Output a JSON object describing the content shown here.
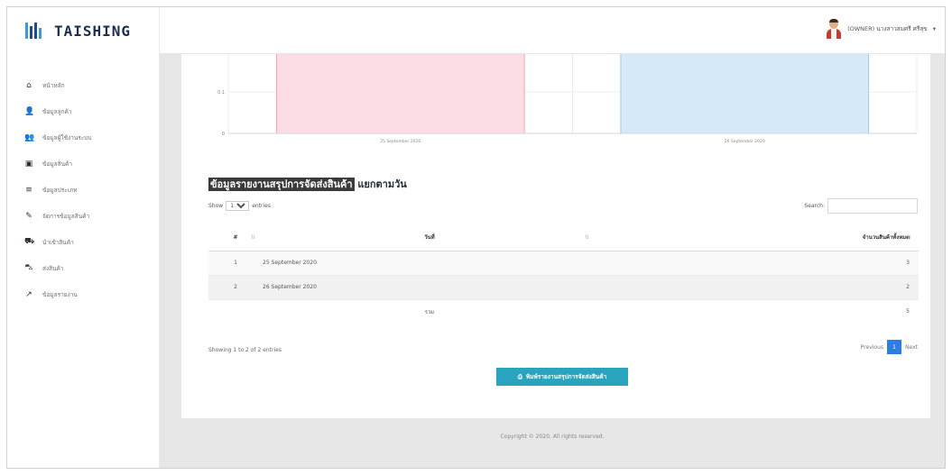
{
  "brand": {
    "name": "TAISHING"
  },
  "user": {
    "name": "(OWNER) นางสาวสมศรี ศรีสุข"
  },
  "sidebar": {
    "items": [
      {
        "label": "หน้าหลัก",
        "icon": "home-icon",
        "glyph": "⌂"
      },
      {
        "label": "ข้อมูลลูกค้า",
        "icon": "user-icon",
        "glyph": "👤"
      },
      {
        "label": "ข้อมูลผู้ใช้งานระบบ",
        "icon": "users-icon",
        "glyph": "👥"
      },
      {
        "label": "ข้อมูลสินค้า",
        "icon": "box-icon",
        "glyph": "▣"
      },
      {
        "label": "ข้อมูลประเภท",
        "icon": "list-icon",
        "glyph": "≡"
      },
      {
        "label": "จัดการข้อมูลสินค้า",
        "icon": "tag-icon",
        "glyph": "✎"
      },
      {
        "label": "นำเข้าสินค้า",
        "icon": "cart-icon",
        "glyph": "⛟"
      },
      {
        "label": "ส่งสินค้า",
        "icon": "truck-icon",
        "glyph": "⛍"
      },
      {
        "label": "ข้อมูลรายงาน",
        "icon": "chart-icon",
        "glyph": "↗"
      }
    ]
  },
  "chart_data": {
    "type": "bar",
    "categories": [
      "25 September 2020",
      "26 September 2020"
    ],
    "series": [
      {
        "values": [
          3,
          2
        ],
        "colors": [
          "#fddde4",
          "#d6e9f8"
        ]
      }
    ],
    "ytick_labels": [
      "0",
      "0.1"
    ],
    "grid": true
  },
  "main": {
    "title_highlight": "ข้อมูลรายงานสรุปการจัดส่งสินค้า",
    "title_rest": " แยกตามวัน",
    "length_label_before": "Show",
    "length_value": "10",
    "length_label_after": "entries",
    "search_label": "Search:",
    "search_value": "",
    "table": {
      "headers": [
        "#",
        "วันที่",
        "จำนวนสินค้าทั้งหมด"
      ],
      "rows": [
        {
          "no": "1",
          "date": "25 September 2020",
          "qty": "3"
        },
        {
          "no": "2",
          "date": "26 September 2020",
          "qty": "2"
        }
      ],
      "total_label": "รวม",
      "total_value": "5"
    },
    "info": "Showing 1 to 2 of 2 entries",
    "pager": {
      "previous": "Previous",
      "current": "1",
      "next": "Next"
    },
    "report_button": "พิมพ์รายงานสรุปการจัดส่งสินค้า"
  },
  "footer": {
    "text": "Copyright © 2020, All rights reserved."
  }
}
